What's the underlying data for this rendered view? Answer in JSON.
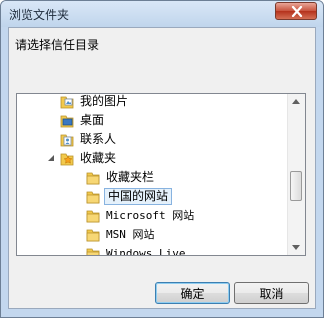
{
  "window": {
    "title": "浏览文件夹",
    "close_icon": "close-icon"
  },
  "prompt": "请选择信任目录",
  "tree": {
    "items": [
      {
        "label": "我的图片",
        "icon": "pictures-folder-icon",
        "indent": 1,
        "selected": false
      },
      {
        "label": "桌面",
        "icon": "desktop-folder-icon",
        "indent": 1,
        "selected": false
      },
      {
        "label": "联系人",
        "icon": "contacts-folder-icon",
        "indent": 1,
        "selected": false
      },
      {
        "label": "收藏夹",
        "icon": "favorites-folder-icon",
        "indent": 1,
        "selected": false,
        "expanded": true
      },
      {
        "label": "收藏夹栏",
        "icon": "folder-icon",
        "indent": 2,
        "selected": false
      },
      {
        "label": "中国的网站",
        "icon": "folder-icon",
        "indent": 2,
        "selected": true
      },
      {
        "label": "Microsoft 网站",
        "icon": "folder-icon",
        "indent": 2,
        "selected": false
      },
      {
        "label": "MSN 网站",
        "icon": "folder-icon",
        "indent": 2,
        "selected": false
      },
      {
        "label": "Windows Live",
        "icon": "folder-icon",
        "indent": 2,
        "selected": false
      }
    ]
  },
  "buttons": {
    "ok": "确定",
    "cancel": "取消"
  },
  "colors": {
    "selection_bg": "#e5f1fb",
    "selection_border": "#88b3e0",
    "folder_yellow": "#f2c94c",
    "close_red": "#c8533d"
  }
}
